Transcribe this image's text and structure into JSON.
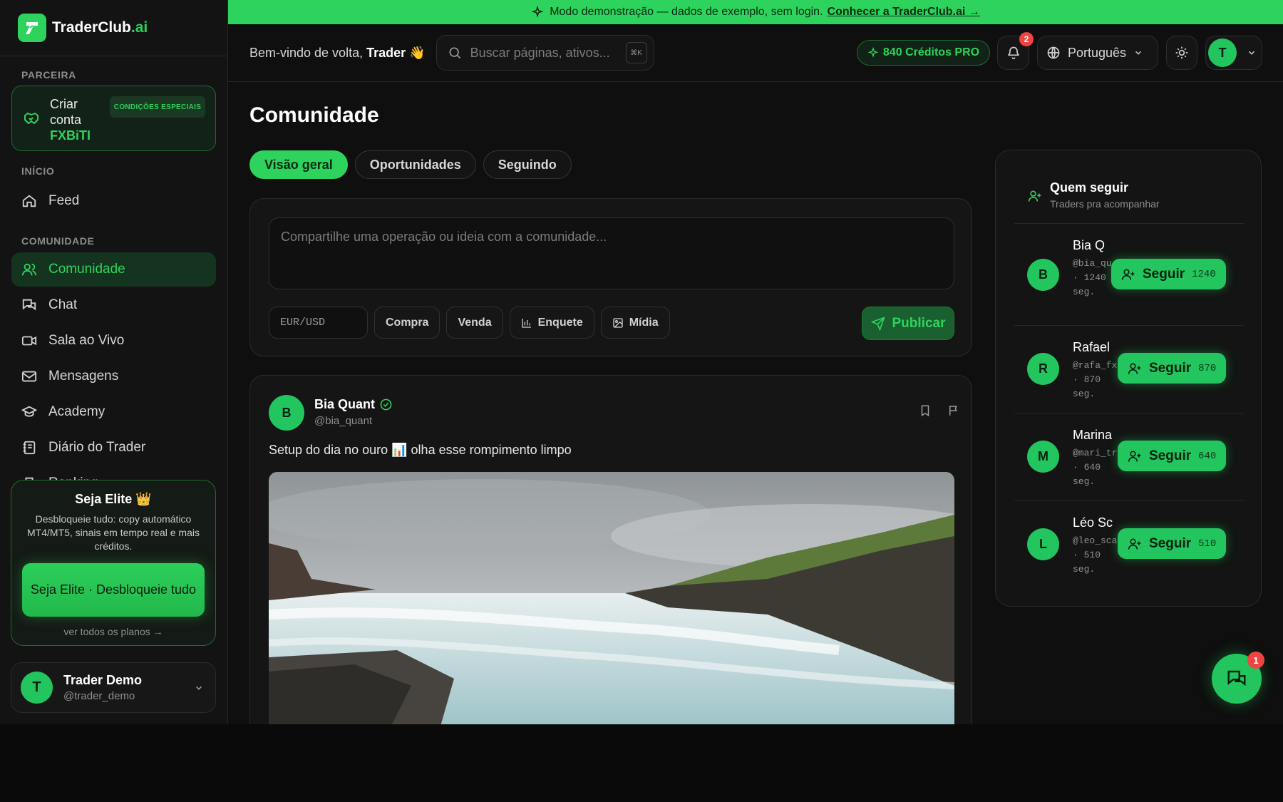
{
  "app": {
    "name_main": "TraderClub",
    "name_suffix": ".ai"
  },
  "banner": {
    "text": "Modo demonstração — dados de exemplo, sem login.",
    "link": "Conhecer a TraderClub.ai →"
  },
  "header": {
    "welcome_prefix": "Bem-vindo de volta,",
    "welcome_name": "Trader",
    "welcome_emoji": "👋",
    "search_placeholder": "Buscar páginas, ativos...",
    "search_shortcut": "⌘K",
    "credits": "840 Créditos PRO",
    "notifications_count": "2",
    "language": "Português",
    "avatar_initial": "T"
  },
  "sidebar": {
    "partner_label": "PARCEIRA",
    "partner_line1": "Criar",
    "partner_line2": "conta",
    "partner_brand": "FXBiTI",
    "partner_badge": "CONDIÇÕES ESPECIAIS",
    "section_start": "INÍCIO",
    "feed": "Feed",
    "section_community": "COMUNIDADE",
    "items": [
      {
        "label": "Comunidade",
        "icon": "users-icon"
      },
      {
        "label": "Chat",
        "icon": "chat-icon"
      },
      {
        "label": "Sala ao Vivo",
        "icon": "video-icon"
      },
      {
        "label": "Mensagens",
        "icon": "mail-icon"
      },
      {
        "label": "Academy",
        "icon": "graduation-cap-icon"
      },
      {
        "label": "Diário do Trader",
        "icon": "notebook-icon"
      },
      {
        "label": "Ranking",
        "icon": "trophy-icon"
      }
    ],
    "elite": {
      "title": "Seja Elite 👑",
      "text": "Desbloqueie tudo: copy automático MT4/MT5, sinais em tempo real e mais créditos.",
      "button": "Seja Elite · Desbloqueie tudo",
      "more": "ver todos os planos →"
    },
    "user": {
      "initial": "T",
      "name": "Trader Demo",
      "handle": "@trader_demo"
    }
  },
  "main": {
    "title": "Comunidade",
    "tabs": [
      "Visão geral",
      "Oportunidades",
      "Seguindo"
    ],
    "composer": {
      "placeholder": "Compartilhe uma operação ou ideia com a comunidade...",
      "pair_placeholder": "EUR/USD",
      "buy": "Compra",
      "sell": "Venda",
      "poll": "Enquete",
      "media": "Mídia",
      "publish": "Publicar"
    },
    "post": {
      "initial": "B",
      "name": "Bia Quant",
      "handle": "@bia_quant",
      "text": "Setup do dia no ouro 📊 olha esse rompimento limpo"
    }
  },
  "follow": {
    "title": "Quem seguir",
    "subtitle": "Traders pra acompanhar",
    "button_label": "Seguir",
    "people": [
      {
        "initial": "B",
        "name": "Bia Q",
        "handle": "@bia_qu",
        "meta": "· 1240 seg.",
        "count": "1240"
      },
      {
        "initial": "R",
        "name": "Rafael",
        "handle": "@rafa_fx",
        "meta": "· 870 seg.",
        "count": "870"
      },
      {
        "initial": "M",
        "name": "Marina",
        "handle": "@mari_tr",
        "meta": "· 640 seg.",
        "count": "640"
      },
      {
        "initial": "L",
        "name": "Léo Sc",
        "handle": "@leo_sca",
        "meta": "· 510 seg.",
        "count": "510"
      }
    ]
  },
  "chat_fab": {
    "badge": "1"
  },
  "colors": {
    "accent": "#2dd35c",
    "background": "#0e0f0e",
    "danger": "#ef4444"
  }
}
